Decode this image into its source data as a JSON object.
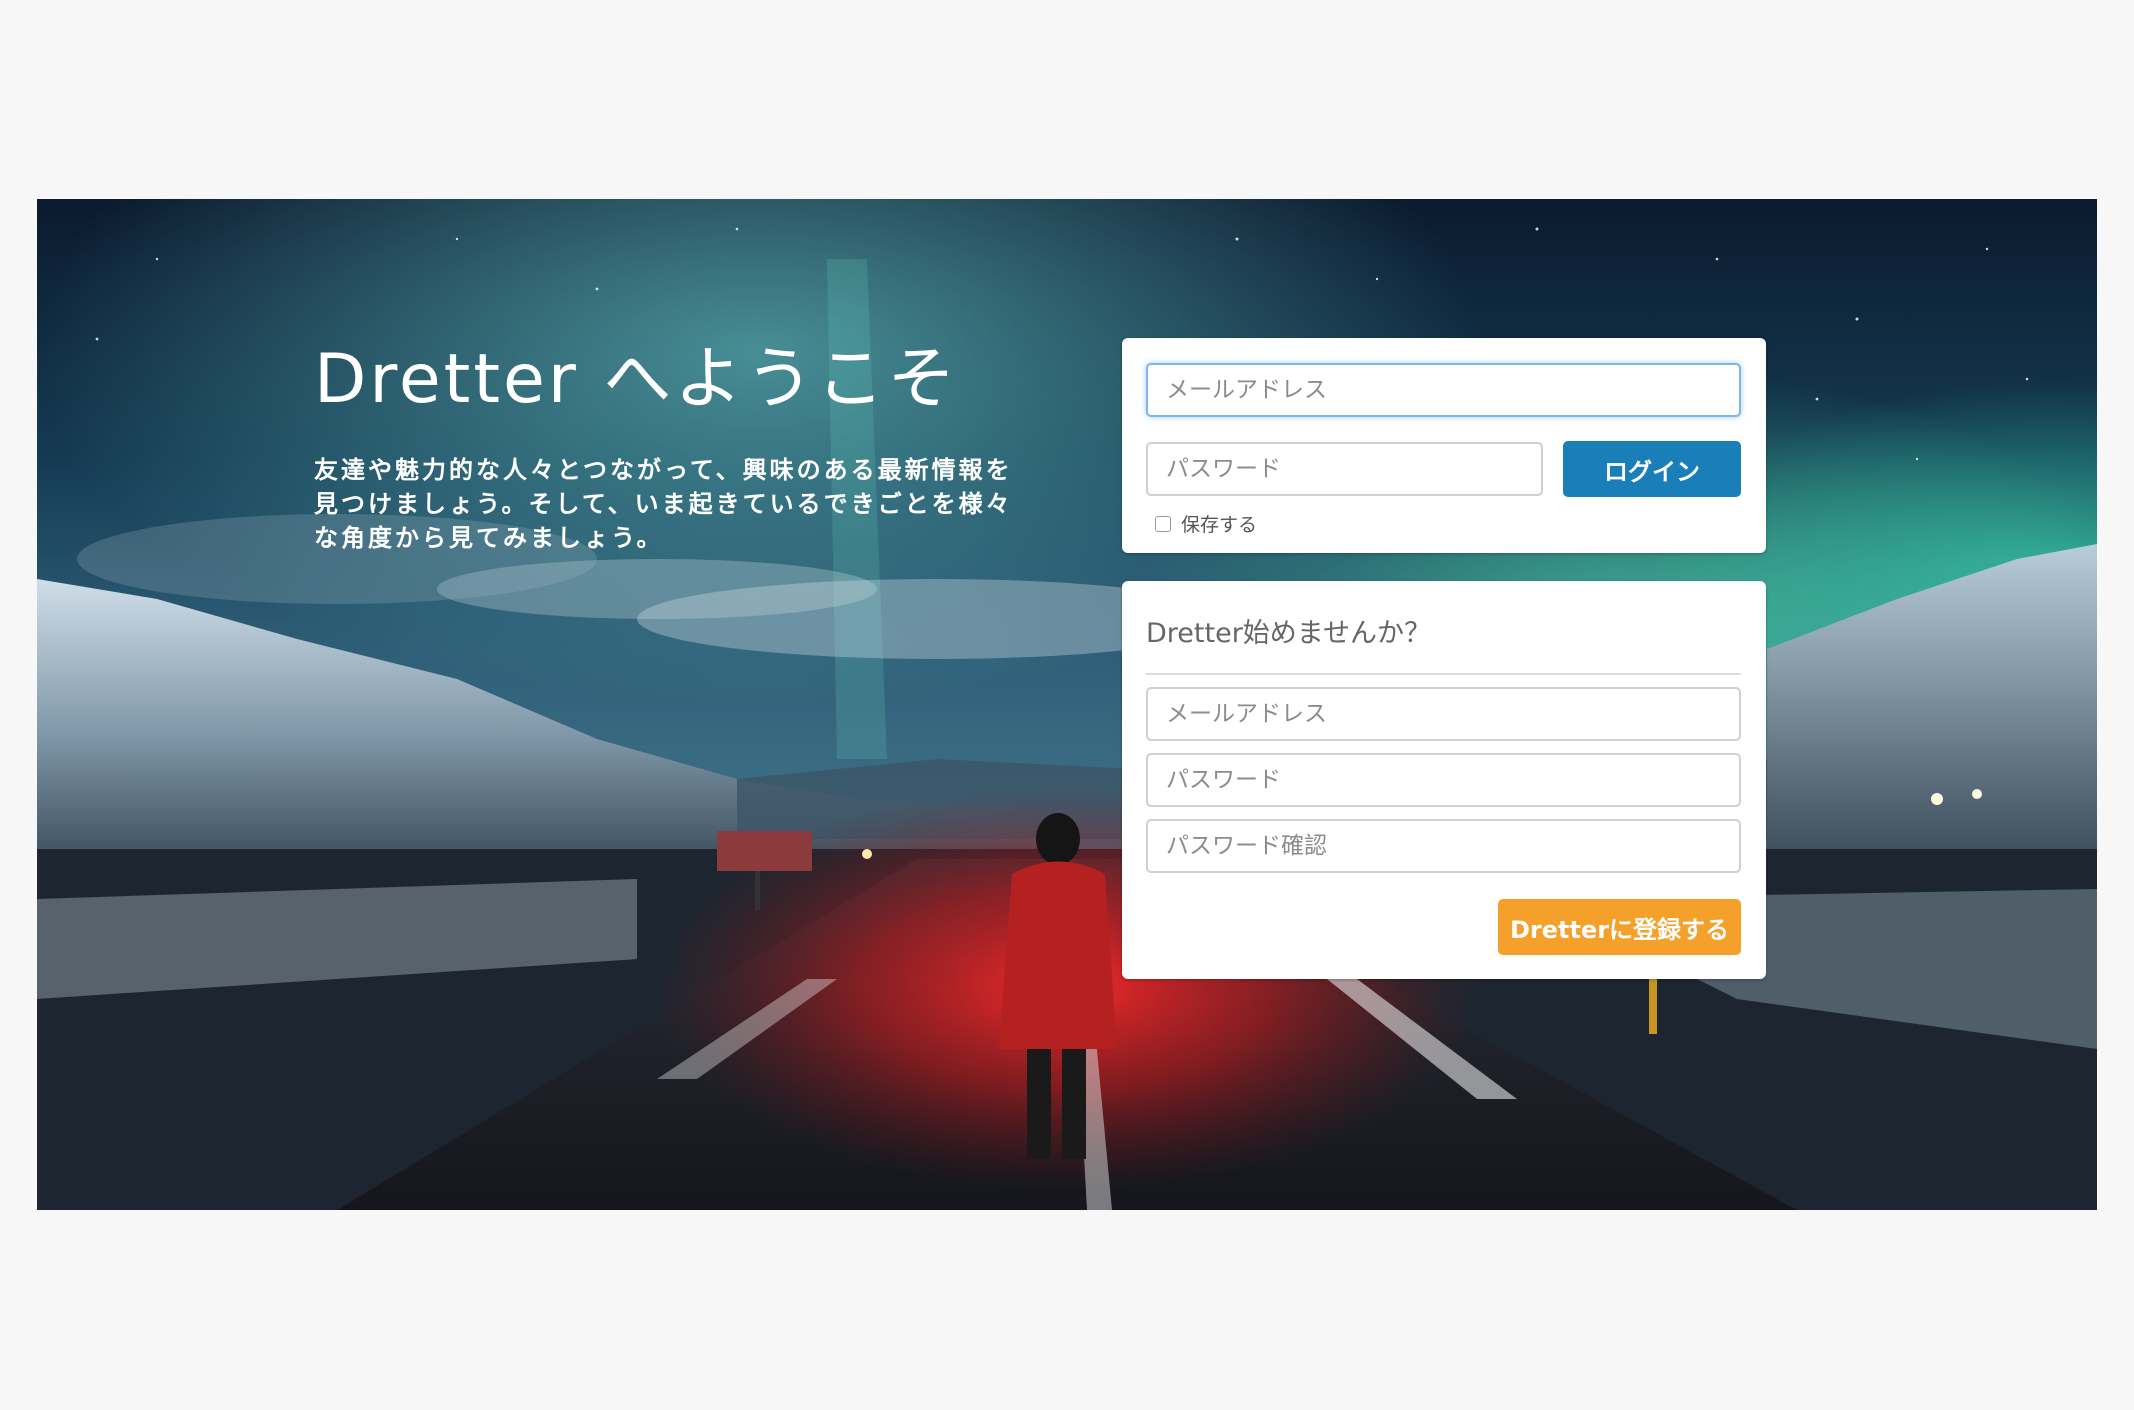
{
  "hero": {
    "title": "Dretter へようこそ",
    "description": "友達や魅力的な人々とつながって、興味のある最新情報を見つけましょう。そして、いま起きているできごとを様々な角度から見てみましょう。"
  },
  "login": {
    "email_placeholder": "メールアドレス",
    "password_placeholder": "パスワード",
    "login_label": "ログイン",
    "remember_label": "保存する",
    "login_color": "#1a7eb8"
  },
  "signup": {
    "title": "Dretter始めませんか？",
    "email_placeholder": "メールアドレス",
    "password_placeholder": "パスワード",
    "confirm_placeholder": "パスワード確認",
    "submit_label": "Dretterに登録する",
    "submit_color": "#f5a02a"
  }
}
